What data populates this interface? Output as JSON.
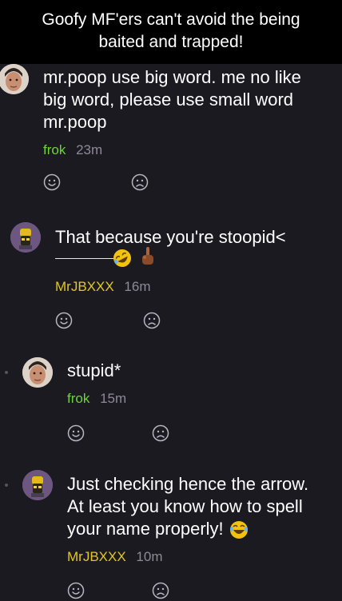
{
  "caption": {
    "line1": "Goofy MF'ers can't avoid the being",
    "line2": "baited and trapped!"
  },
  "comments": [
    {
      "line1": "mr.poop use big word. me no like",
      "line2": "big word, please use small word",
      "line3": "mr.poop",
      "author": "frok",
      "time": "23m"
    },
    {
      "line1": "That because you're stoopid<",
      "author": "MrJBXXX",
      "time": "16m"
    },
    {
      "line1": "stupid*",
      "author": "frok",
      "time": "15m"
    },
    {
      "line1": "Just checking hence the arrow.",
      "line2": "At least you know how to spell",
      "line3": "your name properly!",
      "author": "MrJBXXX",
      "time": "10m"
    }
  ],
  "icons": [
    "smile-icon",
    "frown-icon",
    "rofl-emoji-icon",
    "middle-finger-emoji-icon",
    "laughing-emoji-icon"
  ],
  "colors": {
    "background": "#1b1a21",
    "frok": "#6fd23a",
    "mrjbxxx": "#e2c71e",
    "time": "#8d8a96"
  }
}
